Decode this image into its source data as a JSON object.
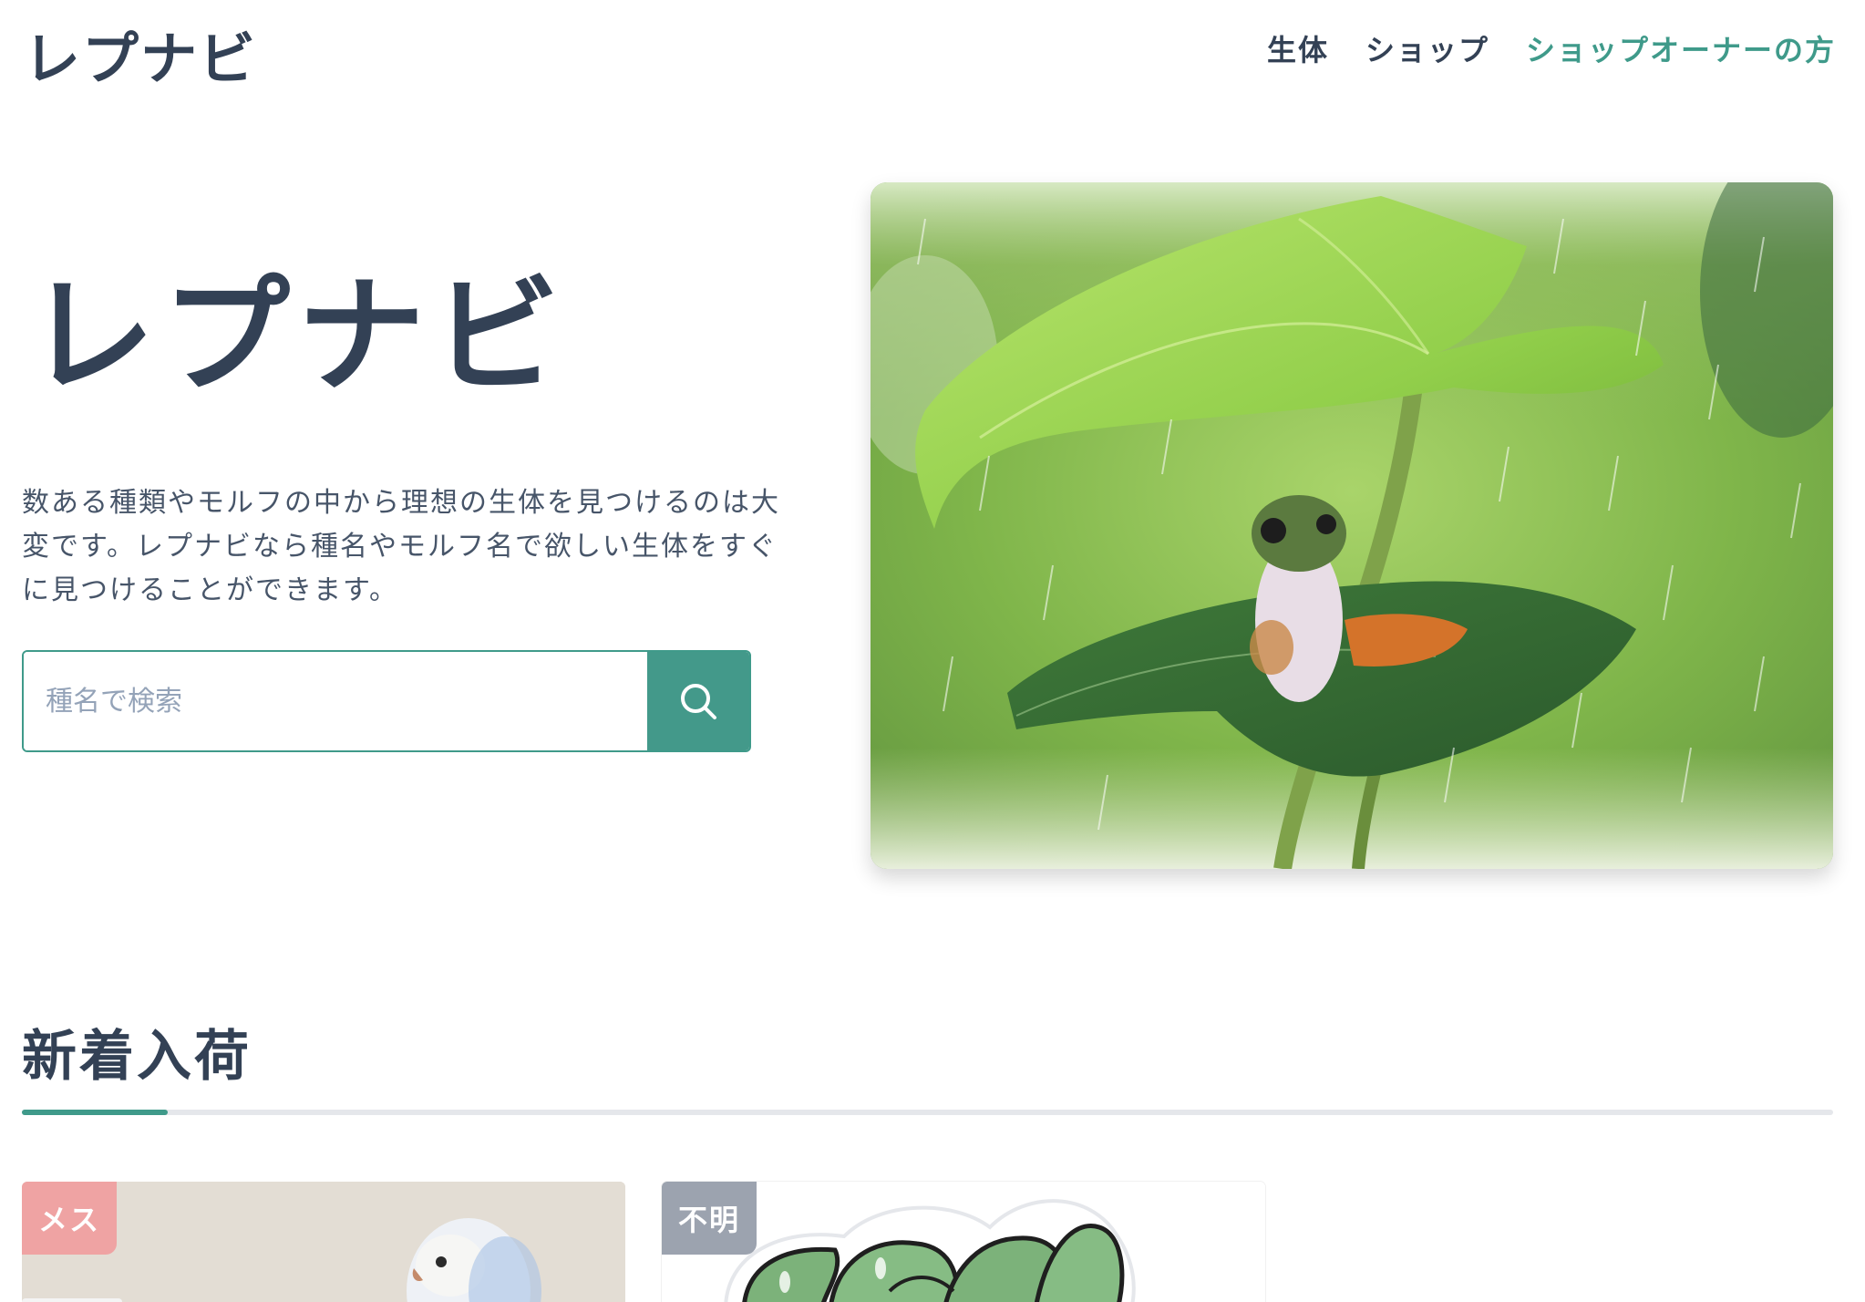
{
  "header": {
    "logo": "レプナビ",
    "nav": {
      "creatures": "生体",
      "shops": "ショップ",
      "owners": "ショップオーナーの方"
    }
  },
  "hero": {
    "title": "レプナビ",
    "description": "数ある種類やモルフの中から理想の生体を見つけるのは大変です。レプナビなら種名やモルフ名で欲しい生体をすぐに見つけることができます。",
    "search_placeholder": "種名で検索",
    "image_alt": "frog-under-leaf-in-rain"
  },
  "new_arrivals": {
    "title": "新着入荷",
    "cards": [
      {
        "badge": "メス",
        "image": "budgerigar"
      },
      {
        "badge": "不明",
        "image": "green-snake-illustration"
      }
    ]
  },
  "colors": {
    "accent": "#3f9a8a",
    "text": "#334155",
    "badge_female": "#efa3a3",
    "badge_unknown": "#9ca3af"
  },
  "icons": {
    "search": "search-icon"
  }
}
